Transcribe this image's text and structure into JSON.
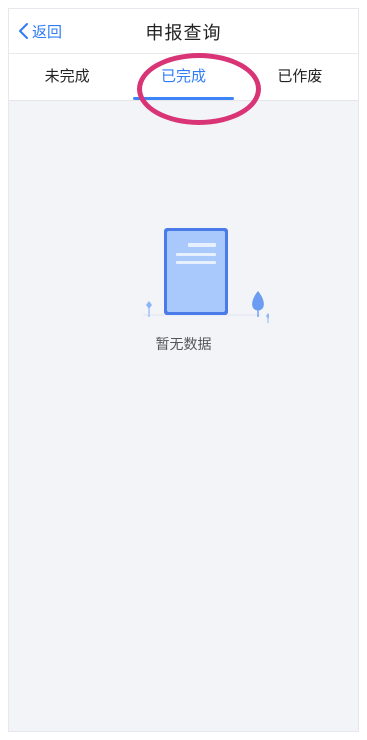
{
  "header": {
    "back_label": "返回",
    "title": "申报查询"
  },
  "tabs": [
    {
      "label": "未完成",
      "active": false
    },
    {
      "label": "已完成",
      "active": true
    },
    {
      "label": "已作废",
      "active": false
    }
  ],
  "empty_state": {
    "icon": "document-icon",
    "message": "暂无数据"
  },
  "colors": {
    "accent": "#2f7cf6",
    "highlight": "#d83476",
    "background": "#f3f4f8"
  }
}
